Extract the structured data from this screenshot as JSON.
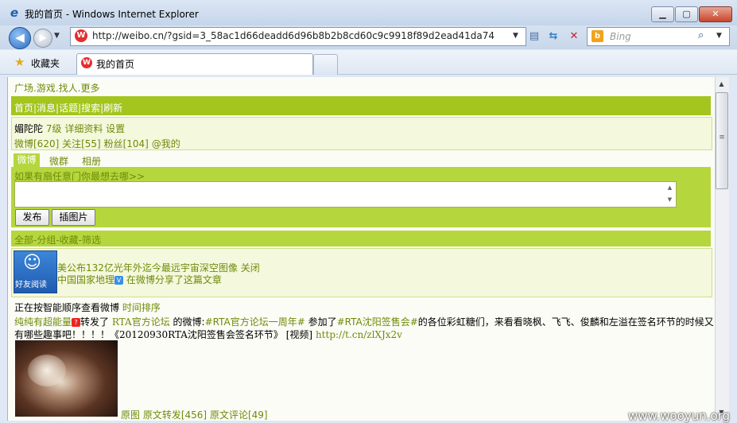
{
  "window": {
    "title": "我的首页 - Windows Internet Explorer",
    "min_label": "▁",
    "max_label": "▢",
    "close_label": "✕"
  },
  "nav": {
    "url": "http://weibo.cn/?gsid=3_58ac1d66deadd6d96b8b2b8cd60c9c9918f89d2ead41da74",
    "search_placeholder": "Bing"
  },
  "favorites": {
    "label": "收藏夹",
    "tab_title": "我的首页"
  },
  "page": {
    "top_links": "广场.游戏.找人.更多",
    "green_nav": "首页|消息|话题|搜索|刷新",
    "profile": {
      "name": "媚陀陀",
      "level": "7级",
      "details": "详细资料",
      "settings": "设置",
      "weibo": "微博[620]",
      "follow": "关注[55]",
      "fans": "粉丝[104]",
      "at_me": "@我的"
    },
    "tabs": [
      "微博",
      "微群",
      "相册"
    ],
    "compose_hint": "如果有扇任意门你最想去哪>>",
    "publish_label": "发布",
    "insert_pic_label": "插图片",
    "filter": "全部-分组-收藏-筛选",
    "promo": {
      "img_label": "好友阅读",
      "line1": "美公布132亿光年外迄今最远宇宙深空图像",
      "close": "关闭",
      "source": "中国国家地理",
      "badge": "V",
      "line2_rest": "在微博分享了这篇文章"
    },
    "sort": {
      "text": "正在按智能顺序查看微博",
      "link": "时间排序"
    },
    "post": {
      "author": "纯纯有超能量",
      "author_badge": "?",
      "t1": "转发了",
      "forum": "RTA官方论坛",
      "t2": "的微博:",
      "tag1": "#RTA官方论坛一周年#",
      "t3": "参加了",
      "tag2": "#RTA沈阳签售会#",
      "t4": "的各位彩虹糖们，来看看晓枫、飞飞、俊麟和左溢在签名环节的时候又",
      "line2_a": "有哪些趣事吧！！！！《20120930RTA沈阳签售会签名环节》",
      "line2_video": "[视频]",
      "line2_url": "http://t.cn/zlXJx2v",
      "actions": [
        "原图",
        "原文转发[456]",
        "原文评论[49]"
      ]
    }
  },
  "watermark": "www.wooyun.org"
}
